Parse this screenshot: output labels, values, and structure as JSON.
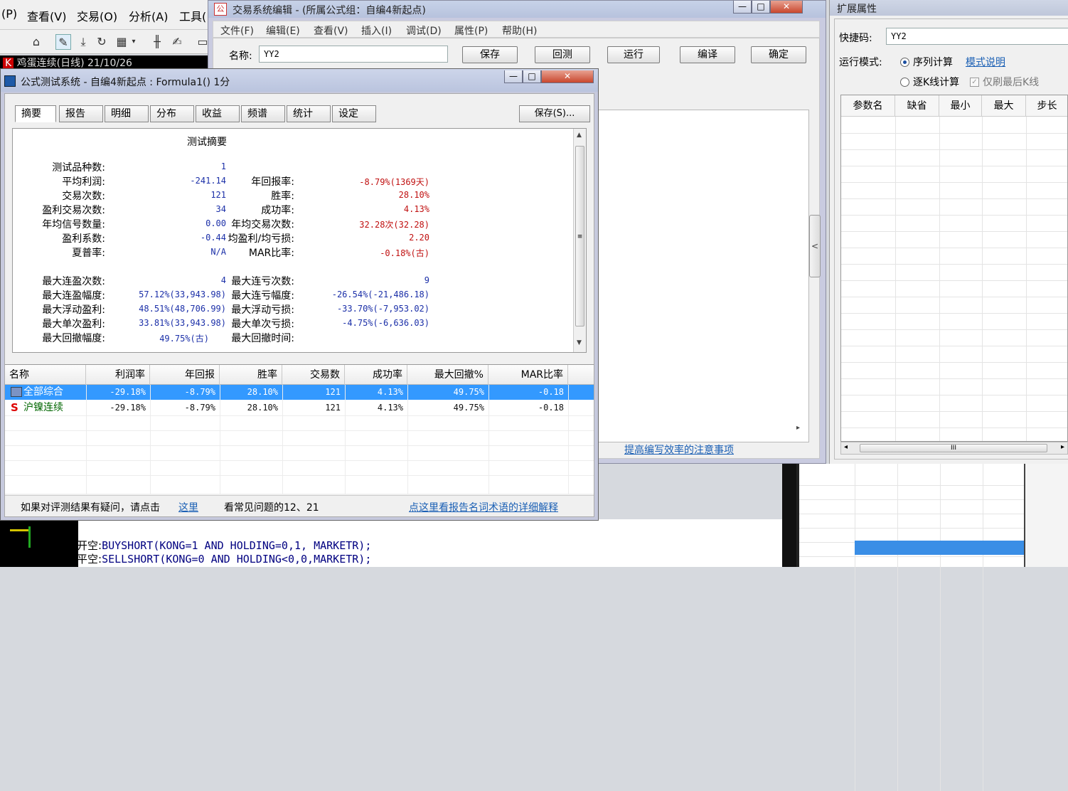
{
  "main_app": {
    "menu": [
      "(P)",
      "查看(V)",
      "交易(O)",
      "分析(A)",
      "工具("
    ],
    "chart_title": "鸡蛋连续(日线) 21/10/26",
    "chart_title_prefix": "K",
    "toolbar_icons": [
      "home-icon",
      "pen-icon",
      "download-icon",
      "refresh-icon",
      "grid-icon",
      "dropdown-icon",
      "candles-icon",
      "edit-icon",
      "panel-icon"
    ]
  },
  "editor": {
    "title": "交易系统编辑 - (所属公式组：自编4新起点)",
    "icon_text": "公",
    "menu": [
      "文件(F)",
      "编辑(E)",
      "查看(V)",
      "插入(I)",
      "调试(D)",
      "属性(P)",
      "帮助(H)"
    ],
    "name_label": "名称:",
    "name_value": "YY2",
    "buttons": [
      "保存",
      "回测",
      "运行",
      "编译",
      "确定"
    ],
    "link": "提高编写效率的注意事项",
    "splitter_glyph": "<",
    "hscroll_glyph": "▸",
    "code": [
      {
        "label": "开空:",
        "fn": "BUYSHORT",
        "args": "(KONG=1 AND HOLDING=0,1, MARKETR);"
      },
      {
        "label": "平空:",
        "fn": "SELLSHORT",
        "args": "(KONG=0 AND HOLDING<0,0,MARKETR);"
      }
    ]
  },
  "ext": {
    "title": "扩展属性",
    "shortcut_label": "快捷码:",
    "shortcut_value": "YY2",
    "mode_label": "运行模式:",
    "mode_sequence": "序列计算",
    "mode_bar": "逐K线计算",
    "mode_link": "模式说明",
    "only_last": "仅刷最后K线",
    "columns": [
      "参数名",
      "缺省",
      "最小",
      "最大",
      "步长"
    ],
    "scroll_glyph": "III"
  },
  "test": {
    "title": "公式测试系统 - 自编4新起点 : Formula1() 1分",
    "tabs": [
      "摘要",
      "报告",
      "明细",
      "分布",
      "收益",
      "频谱",
      "统计",
      "设定"
    ],
    "save": "保存(S)...",
    "summary_title": "测试摘要",
    "left_items": [
      {
        "label": "测试品种数:",
        "value": "1"
      },
      {
        "label": "平均利润:",
        "value": "-241.14"
      },
      {
        "label": "交易次数:",
        "value": "121"
      },
      {
        "label": "盈利交易次数:",
        "value": "34"
      },
      {
        "label": "年均信号数量:",
        "value": "0.00"
      },
      {
        "label": "盈利系数:",
        "value": "-0.44"
      },
      {
        "label": "夏普率:",
        "value": "N/A"
      }
    ],
    "right_items": [
      {
        "label": "年回报率:",
        "value": "-8.79%(1369天)"
      },
      {
        "label": "胜率:",
        "value": "28.10%"
      },
      {
        "label": "成功率:",
        "value": "4.13%"
      },
      {
        "label": "年均交易次数:",
        "value": "32.28次(32.28)"
      },
      {
        "label": "均盈利/均亏损:",
        "value": "2.20"
      },
      {
        "label": "MAR比率:",
        "value": "-0.18%(古)"
      }
    ],
    "left_items2": [
      {
        "label": "最大连盈次数:",
        "value": "4"
      },
      {
        "label": "最大连盈幅度:",
        "value": "57.12%(33,943.98)"
      },
      {
        "label": "最大浮动盈利:",
        "value": "48.51%(48,706.99)"
      },
      {
        "label": "最大单次盈利:",
        "value": "33.81%(33,943.98)"
      },
      {
        "label": "最大回撤幅度:",
        "value": "49.75%(古)"
      }
    ],
    "right_items2": [
      {
        "label": "最大连亏次数:",
        "value": "9"
      },
      {
        "label": "最大连亏幅度:",
        "value": "-26.54%(-21,486.18)"
      },
      {
        "label": "最大浮动亏损:",
        "value": "-33.70%(-7,953.02)"
      },
      {
        "label": "最大单次亏损:",
        "value": "-4.75%(-6,636.03)"
      },
      {
        "label": "最大回撤时间:",
        "value": ""
      }
    ],
    "result_columns": [
      "名称",
      "利润率",
      "年回报",
      "胜率",
      "交易数",
      "成功率",
      "最大回撤%",
      "MAR比率"
    ],
    "result_rows": [
      [
        "全部综合",
        "-29.18%",
        "-8.79%",
        "28.10%",
        "121",
        "4.13%",
        "49.75%",
        "-0.18"
      ],
      [
        "沪镍连续",
        "-29.18%",
        "-8.79%",
        "28.10%",
        "121",
        "4.13%",
        "49.75%",
        "-0.18"
      ]
    ],
    "row_icons": [
      "folder-icon",
      "stock-s-icon"
    ],
    "s_glyph": "S",
    "footer_text": "如果对评测结果有疑问，请点击",
    "footer_link": "这里",
    "footer_faq": "看常见问题的12、21",
    "footer_link2": "点这里看报告名词术语的详细解释"
  },
  "colors": {
    "accent": "#3399ff",
    "link": "#1a5fb4",
    "positive_blue": "#1b2fa8",
    "negative_red": "#c01010"
  }
}
